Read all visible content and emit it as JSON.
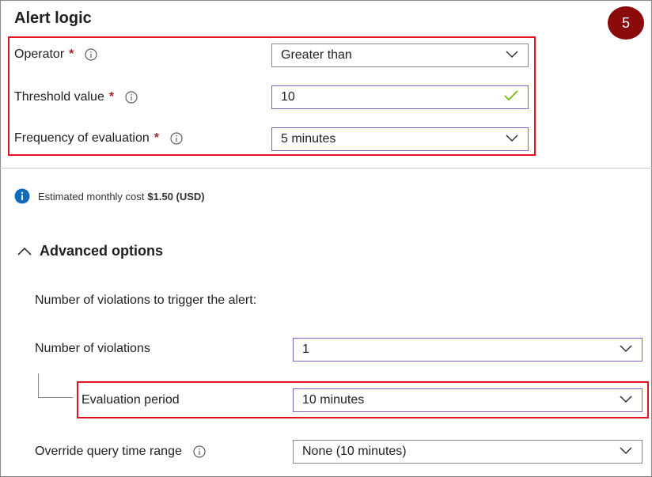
{
  "header": {
    "title": "Alert logic",
    "step_badge": "5"
  },
  "operator": {
    "label": "Operator",
    "required_mark": "*",
    "value": "Greater than"
  },
  "threshold": {
    "label": "Threshold value",
    "required_mark": "*",
    "value": "10"
  },
  "frequency": {
    "label": "Frequency of evaluation",
    "required_mark": "*",
    "value": "5 minutes"
  },
  "cost": {
    "text": "Estimated monthly cost",
    "amount": "$1.50 (USD)"
  },
  "advanced": {
    "title": "Advanced options",
    "violations_intro": "Number of violations to trigger the alert:",
    "violations": {
      "label": "Number of violations",
      "value": "1"
    },
    "evaluation_period": {
      "label": "Evaluation period",
      "value": "10 minutes"
    },
    "override": {
      "label": "Override query time range",
      "value": "None (10 minutes)"
    }
  },
  "colors": {
    "highlight": "#e81123",
    "badge": "#8b0a0a",
    "info_blue": "#0f6cbd",
    "valid_check": "#6bb700",
    "focus_border": "#8661c5"
  },
  "icons": [
    "info-icon",
    "chevron-down-icon",
    "checkmark-icon",
    "chevron-up-icon",
    "info-filled-icon"
  ]
}
